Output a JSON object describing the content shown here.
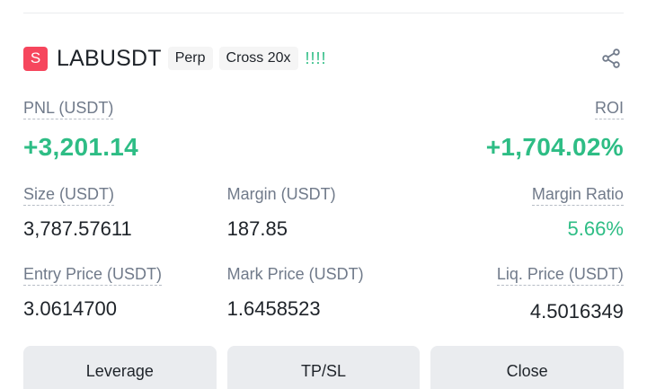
{
  "position": {
    "side_badge": "S",
    "symbol": "LABUSDT",
    "contract_type": "Perp",
    "margin_mode": "Cross 20x",
    "signal_bars": "!!!!",
    "share_icon": "share-icon"
  },
  "pnl": {
    "label": "PNL (USDT)",
    "value": "+3,201.14",
    "roi_label": "ROI",
    "roi_value": "+1,704.02%"
  },
  "details": {
    "size_label": "Size (USDT)",
    "size_value": "3,787.57611",
    "margin_label": "Margin (USDT)",
    "margin_value": "187.85",
    "margin_ratio_label": "Margin Ratio",
    "margin_ratio_value": "5.66%",
    "entry_price_label": "Entry Price (USDT)",
    "entry_price_value": "3.0614700",
    "mark_price_label": "Mark Price (USDT)",
    "mark_price_value": "1.6458523",
    "liq_price_label": "Liq. Price (USDT)",
    "liq_price_value": "4.5016349"
  },
  "actions": {
    "leverage": "Leverage",
    "tpsl": "TP/SL",
    "close": "Close"
  },
  "colors": {
    "profit_green": "#2ebd85",
    "short_red": "#f6465d"
  }
}
